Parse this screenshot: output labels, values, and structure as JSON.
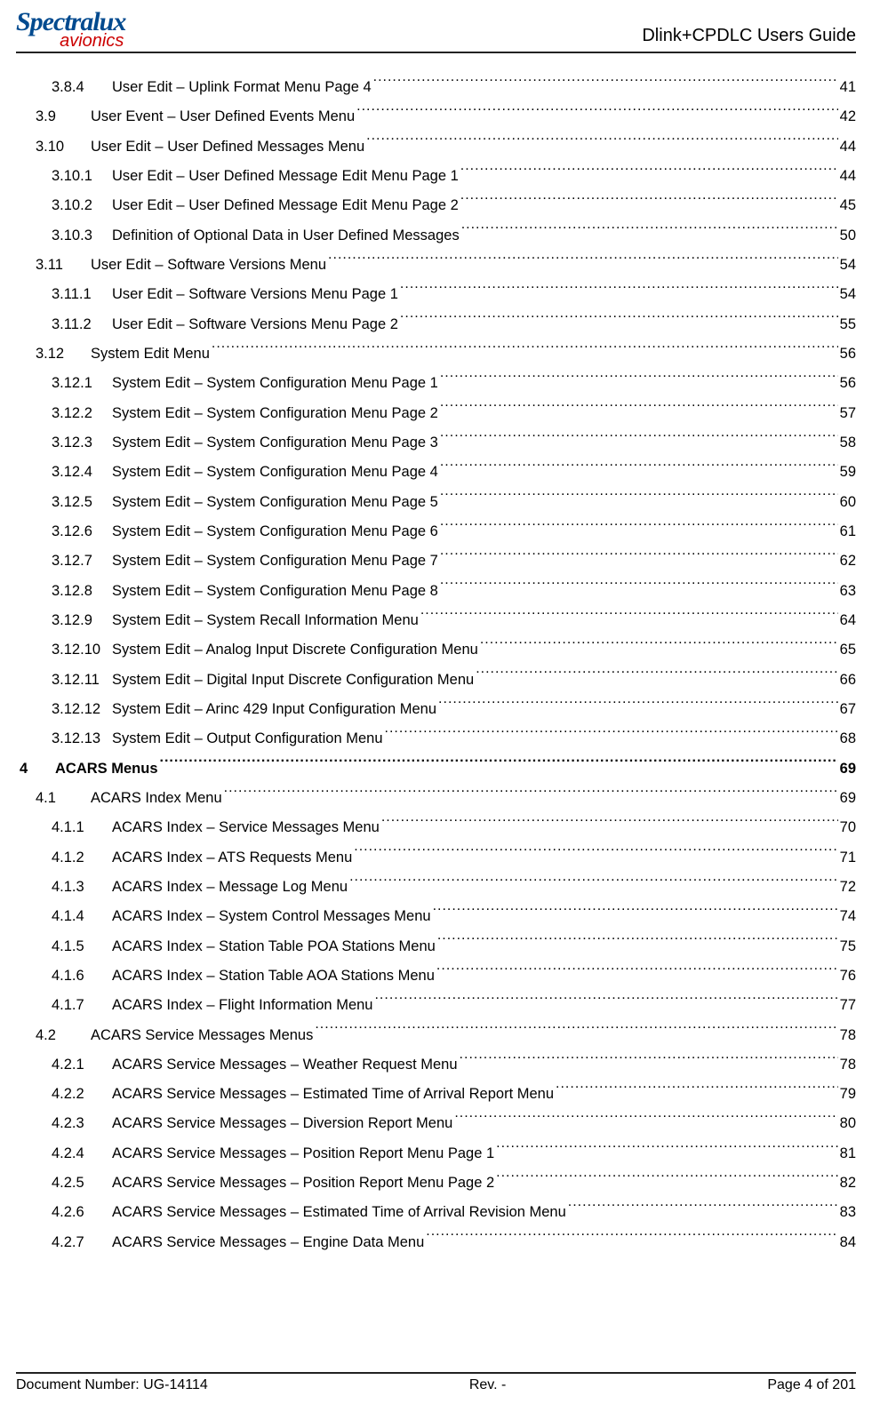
{
  "header": {
    "logo_top": "Spectralux",
    "logo_bottom": "avionics",
    "title": "Dlink+CPDLC Users Guide"
  },
  "toc": [
    {
      "level": 3,
      "num": "3.8.4",
      "title": "User Edit – Uplink Format Menu Page 4",
      "page": "41"
    },
    {
      "level": 1,
      "num": "3.9",
      "title": "User Event – User Defined Events Menu",
      "page": "42"
    },
    {
      "level": 1,
      "num": "3.10",
      "title": "User Edit – User Defined Messages Menu",
      "page": "44"
    },
    {
      "level": 2,
      "num": "3.10.1",
      "title": "User Edit – User Defined Message Edit Menu Page 1",
      "page": "44"
    },
    {
      "level": 2,
      "num": "3.10.2",
      "title": "User Edit – User Defined Message Edit Menu Page 2",
      "page": "45"
    },
    {
      "level": 2,
      "num": "3.10.3",
      "title": "Definition of Optional Data in User Defined Messages",
      "page": "50"
    },
    {
      "level": 1,
      "num": "3.11",
      "title": "User Edit – Software Versions Menu",
      "page": "54"
    },
    {
      "level": 2,
      "num": "3.11.1",
      "title": "User Edit – Software Versions Menu Page 1",
      "page": "54"
    },
    {
      "level": 2,
      "num": "3.11.2",
      "title": "User Edit – Software Versions Menu Page 2",
      "page": "55"
    },
    {
      "level": 1,
      "num": "3.12",
      "title": "System Edit Menu",
      "page": "56"
    },
    {
      "level": 2,
      "num": "3.12.1",
      "title": "System Edit – System Configuration Menu Page 1",
      "page": "56"
    },
    {
      "level": 2,
      "num": "3.12.2",
      "title": "System Edit – System Configuration Menu Page 2",
      "page": "57"
    },
    {
      "level": 2,
      "num": "3.12.3",
      "title": "System Edit – System Configuration Menu Page 3",
      "page": "58"
    },
    {
      "level": 2,
      "num": "3.12.4",
      "title": "System Edit – System Configuration Menu Page 4",
      "page": "59"
    },
    {
      "level": 2,
      "num": "3.12.5",
      "title": "System Edit – System Configuration Menu Page 5",
      "page": "60"
    },
    {
      "level": 2,
      "num": "3.12.6",
      "title": "System Edit – System Configuration Menu Page 6",
      "page": "61"
    },
    {
      "level": 2,
      "num": "3.12.7",
      "title": "System Edit – System Configuration Menu Page 7",
      "page": "62"
    },
    {
      "level": 2,
      "num": "3.12.8",
      "title": "System Edit – System Configuration Menu Page 8",
      "page": "63"
    },
    {
      "level": 2,
      "num": "3.12.9",
      "title": "System Edit – System Recall Information Menu",
      "page": "64"
    },
    {
      "level": 2,
      "num": "3.12.10",
      "title": "System Edit – Analog Input Discrete Configuration Menu",
      "page": "65"
    },
    {
      "level": 2,
      "num": "3.12.11",
      "title": "System Edit – Digital Input Discrete Configuration Menu",
      "page": "66"
    },
    {
      "level": 2,
      "num": "3.12.12",
      "title": "System Edit – Arinc 429 Input Configuration Menu",
      "page": "67"
    },
    {
      "level": 2,
      "num": "3.12.13",
      "title": "System Edit – Output Configuration Menu",
      "page": "68"
    },
    {
      "level": 0,
      "num": "4",
      "title": "ACARS Menus",
      "page": "69"
    },
    {
      "level": 1,
      "num": "4.1",
      "title": "ACARS Index Menu",
      "page": "69"
    },
    {
      "level": 3,
      "num": "4.1.1",
      "title": "ACARS Index – Service Messages Menu",
      "page": "70"
    },
    {
      "level": 3,
      "num": "4.1.2",
      "title": "ACARS Index – ATS Requests Menu",
      "page": "71"
    },
    {
      "level": 3,
      "num": "4.1.3",
      "title": "ACARS Index – Message Log Menu",
      "page": "72"
    },
    {
      "level": 3,
      "num": "4.1.4",
      "title": "ACARS Index – System Control Messages Menu",
      "page": "74"
    },
    {
      "level": 3,
      "num": "4.1.5",
      "title": "ACARS Index – Station Table POA Stations Menu",
      "page": "75"
    },
    {
      "level": 3,
      "num": "4.1.6",
      "title": "ACARS Index – Station Table AOA Stations Menu",
      "page": "76"
    },
    {
      "level": 3,
      "num": "4.1.7",
      "title": "ACARS Index – Flight Information Menu",
      "page": "77"
    },
    {
      "level": 1,
      "num": "4.2",
      "title": "ACARS Service Messages Menus",
      "page": "78"
    },
    {
      "level": 3,
      "num": "4.2.1",
      "title": "ACARS Service Messages – Weather Request Menu",
      "page": "78"
    },
    {
      "level": 3,
      "num": "4.2.2",
      "title": "ACARS Service Messages – Estimated Time of Arrival Report Menu",
      "page": "79"
    },
    {
      "level": 3,
      "num": "4.2.3",
      "title": "ACARS Service Messages – Diversion Report Menu",
      "page": "80"
    },
    {
      "level": 3,
      "num": "4.2.4",
      "title": "ACARS Service Messages – Position Report Menu Page 1",
      "page": "81"
    },
    {
      "level": 3,
      "num": "4.2.5",
      "title": "ACARS Service Messages – Position Report Menu Page 2",
      "page": "82"
    },
    {
      "level": 3,
      "num": "4.2.6",
      "title": "ACARS Service Messages – Estimated Time of Arrival Revision Menu",
      "page": "83"
    },
    {
      "level": 3,
      "num": "4.2.7",
      "title": "ACARS Service Messages – Engine Data Menu",
      "page": "84"
    }
  ],
  "footer": {
    "doc_number": "Document Number:  UG-14114",
    "revision": "Rev. -",
    "page": "Page 4 of 201"
  }
}
